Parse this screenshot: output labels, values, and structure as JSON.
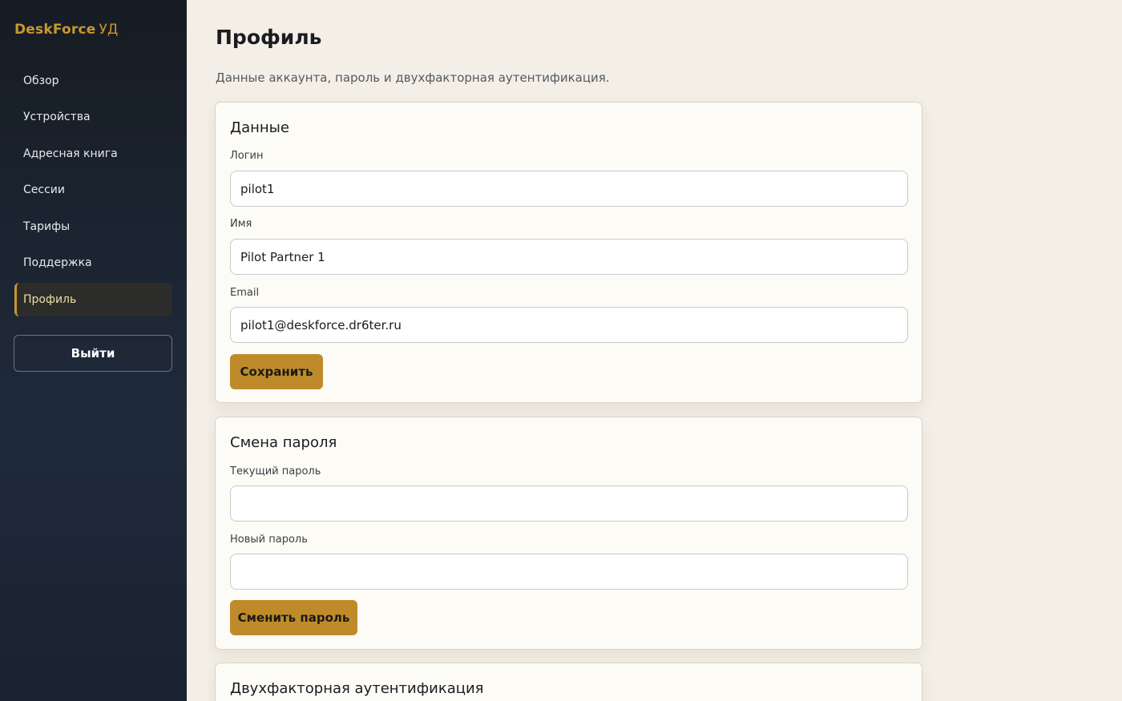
{
  "brand": {
    "name": "DeskForce",
    "suffix": "УД",
    "accent_color": "#c9972f"
  },
  "sidebar": {
    "items": [
      {
        "label": "Обзор"
      },
      {
        "label": "Устройства"
      },
      {
        "label": "Адресная книга"
      },
      {
        "label": "Сессии"
      },
      {
        "label": "Тарифы"
      },
      {
        "label": "Поддержка"
      },
      {
        "label": "Профиль",
        "active": true
      }
    ],
    "logout_label": "Выйти"
  },
  "page": {
    "title": "Профиль",
    "subtitle": "Данные аккаунта, пароль и двухфакторная аутентификация."
  },
  "profile_card": {
    "title": "Данные",
    "login_label": "Логин",
    "login_value": "pilot1",
    "name_label": "Имя",
    "name_value": "Pilot Partner 1",
    "email_label": "Email",
    "email_value": "pilot1@deskforce.dr6ter.ru",
    "save_label": "Сохранить"
  },
  "password_card": {
    "title": "Смена пароля",
    "current_label": "Текущий пароль",
    "current_value": "",
    "new_label": "Новый пароль",
    "new_value": "",
    "submit_label": "Сменить пароль"
  },
  "twofa_card": {
    "title": "Двухфакторная аутентификация"
  },
  "colors": {
    "sidebar_bg": "#1a2230",
    "page_bg": "#f3efe7",
    "button": "#bf8b2a"
  }
}
